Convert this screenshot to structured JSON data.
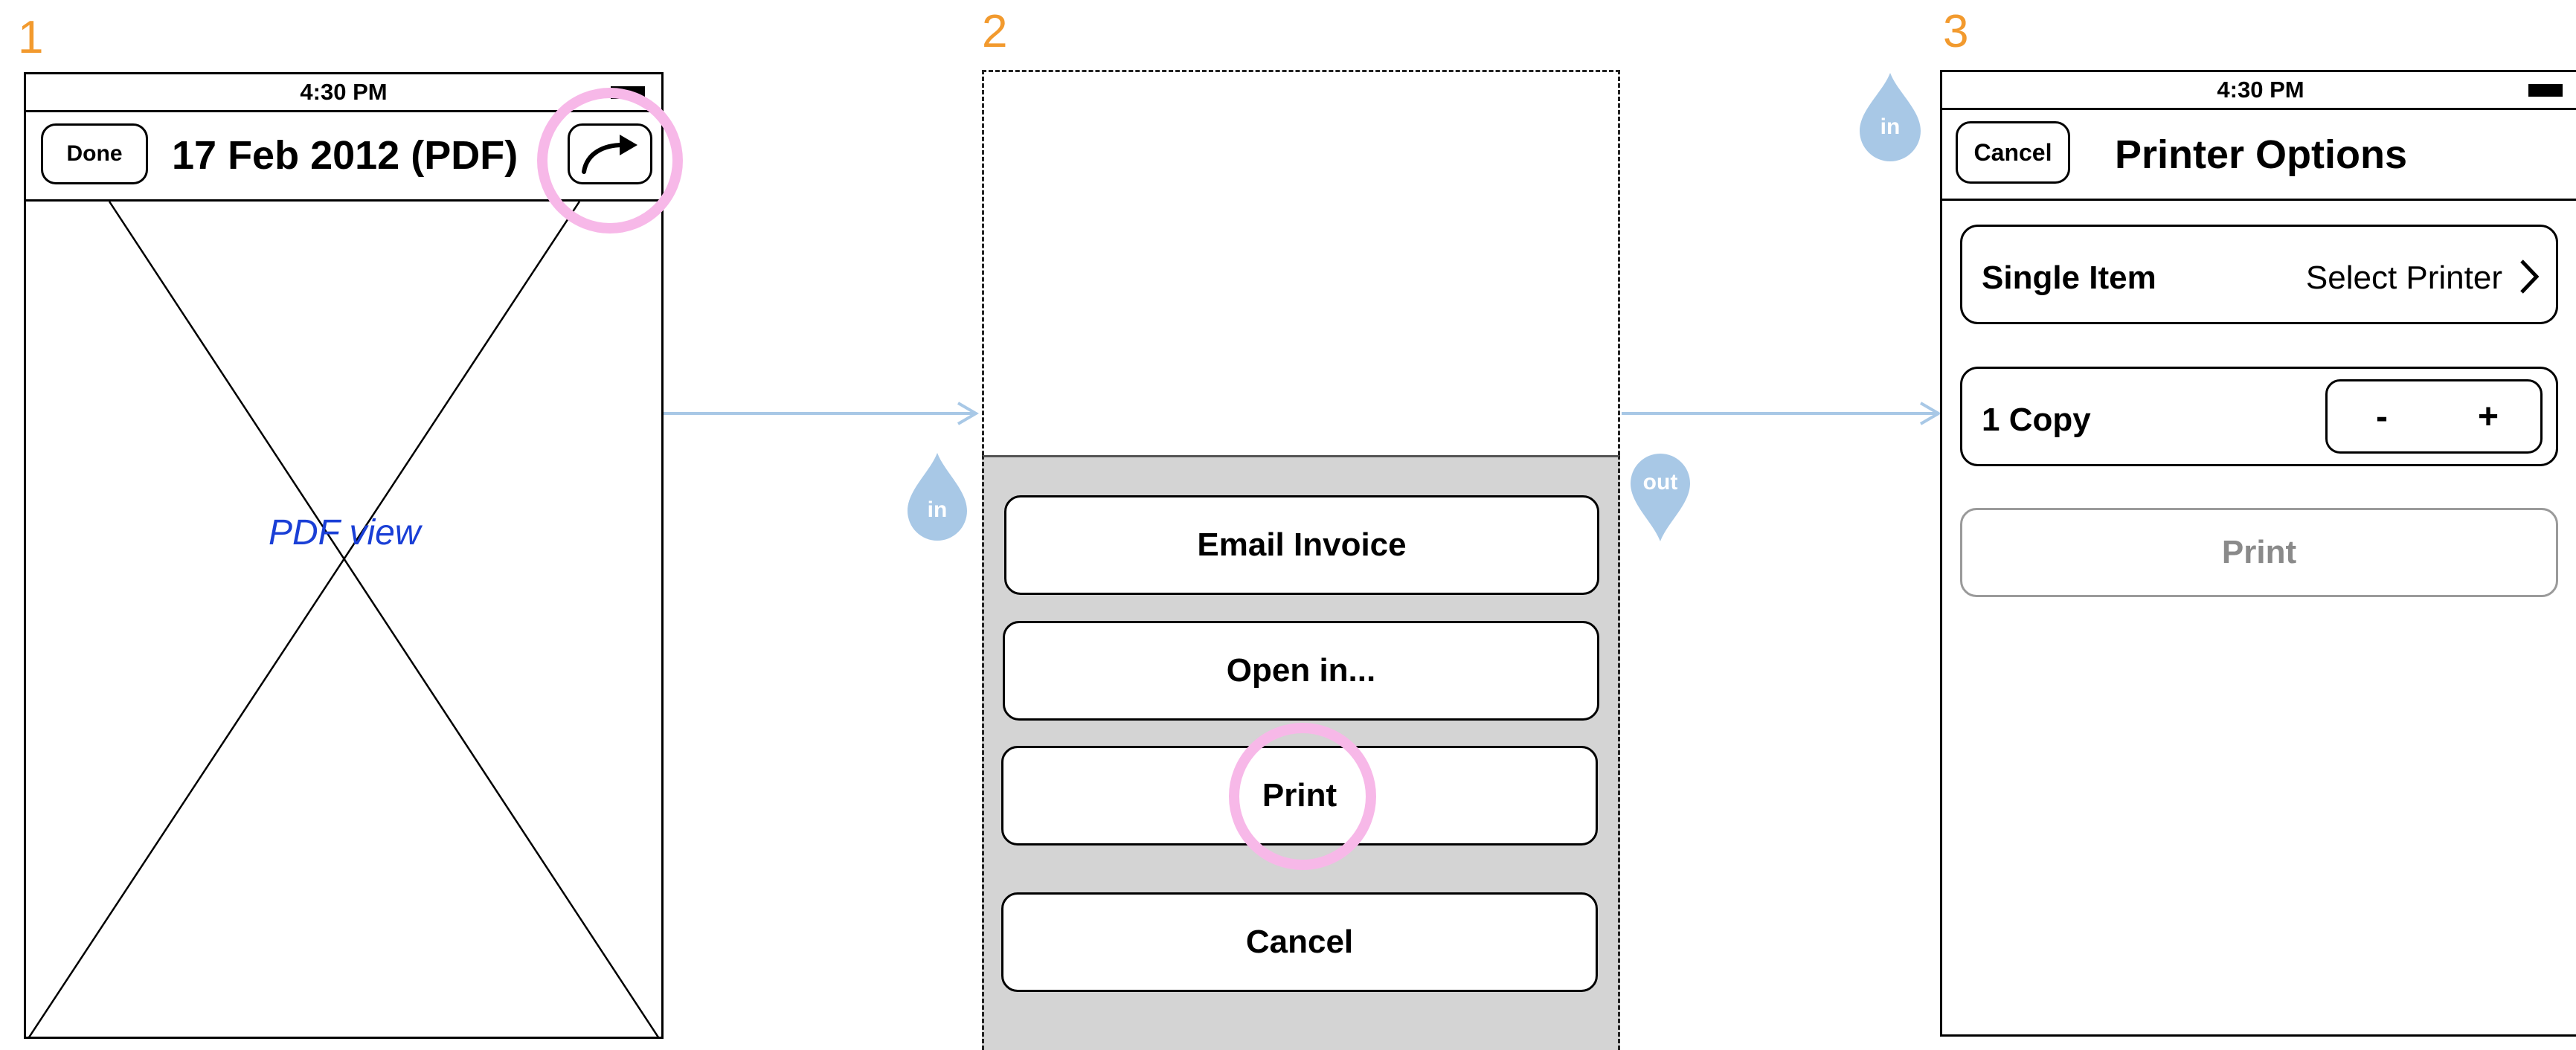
{
  "steps": [
    "1",
    "2",
    "3"
  ],
  "screen1": {
    "status_time": "4:30 PM",
    "done_label": "Done",
    "title": "17 Feb 2012 (PDF)",
    "share_icon": "share-arrow-icon",
    "pdf_placeholder_label": "PDF view"
  },
  "screen2": {
    "buttons": [
      "Email Invoice",
      "Open in...",
      "Print",
      "Cancel"
    ]
  },
  "screen3": {
    "status_time": "4:30 PM",
    "cancel_label": "Cancel",
    "title": "Printer Options",
    "item_label": "Single Item",
    "printer_value": "Select Printer",
    "copies_label": "1 Copy",
    "minus_label": "-",
    "plus_label": "+",
    "print_label": "Print"
  },
  "transitions": {
    "in_label": "in",
    "out_label": "out"
  },
  "colors": {
    "step_number": "#f29a2e",
    "arrow": "#a8c8e6",
    "drop": "#a8c8e6",
    "highlight": "#f7b8e8",
    "pdf_label": "#1a3fd6",
    "sheet_bg": "#d4d4d4",
    "disabled_text": "#8a8a8a"
  }
}
